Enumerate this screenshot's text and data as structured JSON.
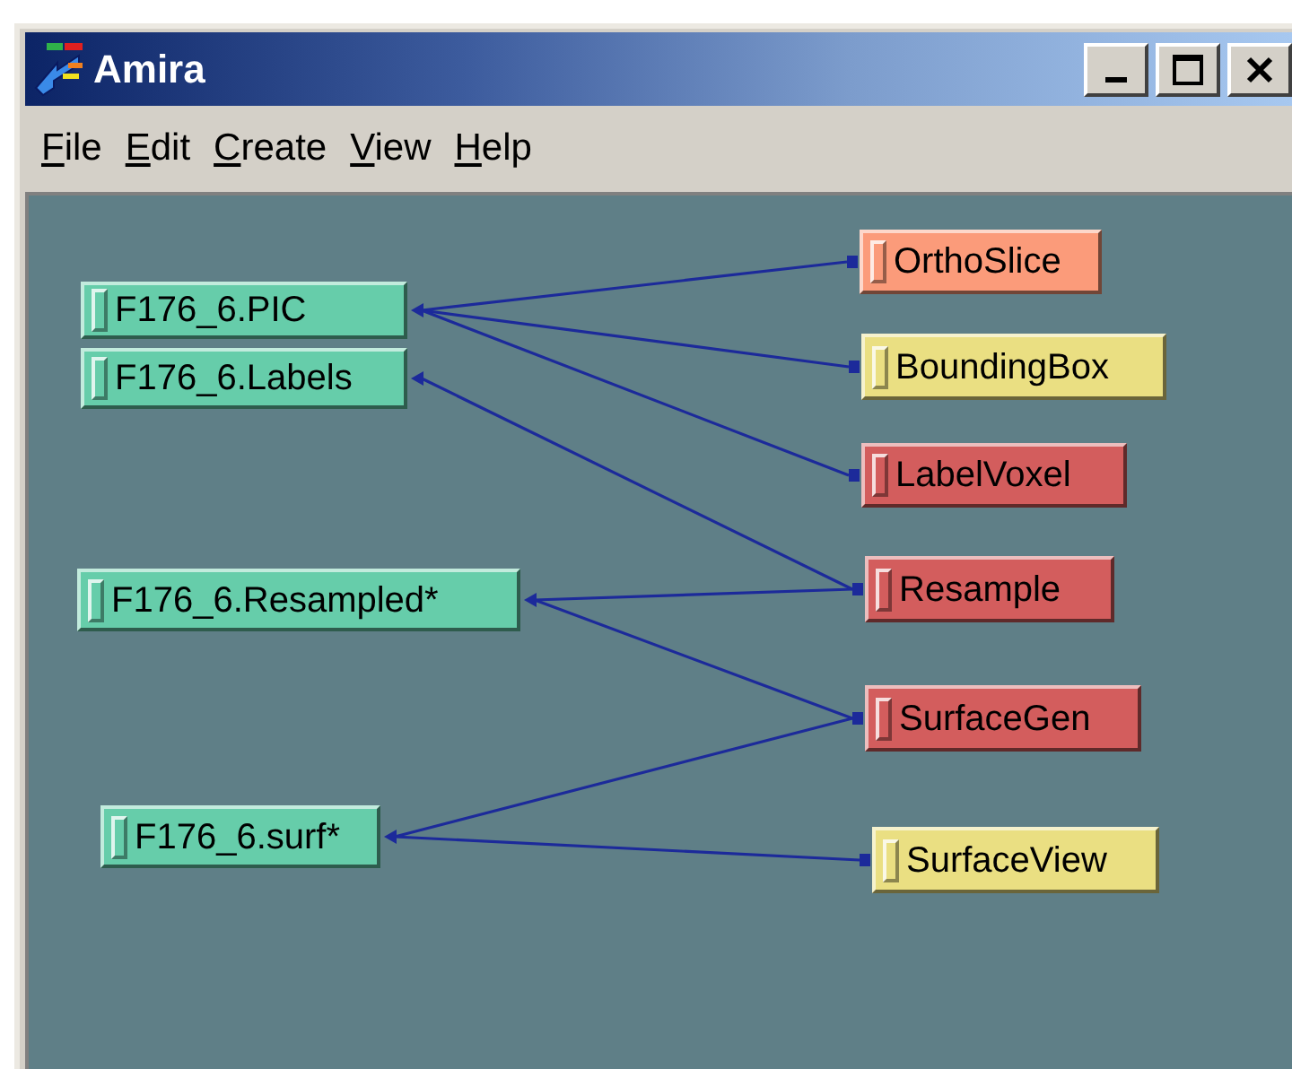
{
  "window": {
    "title": "Amira"
  },
  "menu": [
    "File",
    "Edit",
    "Create",
    "View",
    "Help"
  ],
  "data_objects": [
    {
      "label": "F176_6.PIC",
      "color": "#66cdaa"
    },
    {
      "label": "F176_6.Labels",
      "color": "#66cdaa"
    },
    {
      "label": "F176_6.Resampled*",
      "color": "#66cdaa"
    },
    {
      "label": "F176_6.surf*",
      "color": "#66cdaa"
    }
  ],
  "modules": [
    {
      "label": "OrthoSlice",
      "color": "#fb9b7a"
    },
    {
      "label": "BoundingBox",
      "color": "#eadf82"
    },
    {
      "label": "LabelVoxel",
      "color": "#d35d5d"
    },
    {
      "label": "Resample",
      "color": "#d35d5d"
    },
    {
      "label": "SurfaceGen",
      "color": "#d35d5d"
    },
    {
      "label": "SurfaceView",
      "color": "#eadf82"
    }
  ]
}
